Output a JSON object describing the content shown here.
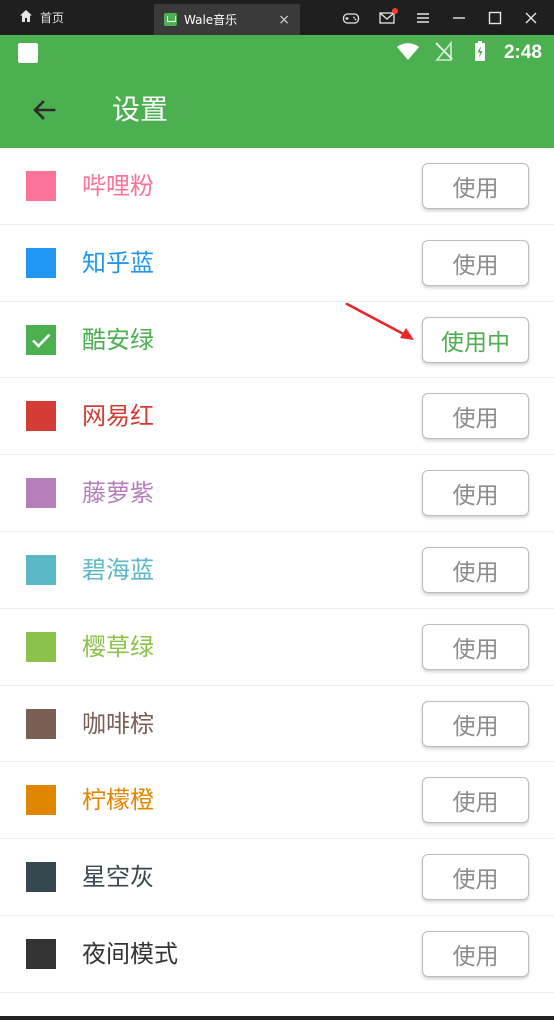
{
  "emulator": {
    "home_label": "首页",
    "tab_title": "Wale音乐",
    "tab_close": "×"
  },
  "status_bar": {
    "time": "2:48"
  },
  "toolbar": {
    "title": "设置"
  },
  "themes": [
    {
      "name": "哔哩粉",
      "color": "#fb7299",
      "button": "使用",
      "active": false
    },
    {
      "name": "知乎蓝",
      "color": "#2196f3",
      "button": "使用",
      "active": false
    },
    {
      "name": "酷安绿",
      "color": "#4caf50",
      "button": "使用中",
      "active": true
    },
    {
      "name": "网易红",
      "color": "#d43c33",
      "button": "使用",
      "active": false
    },
    {
      "name": "藤萝紫",
      "color": "#b57fbb",
      "button": "使用",
      "active": false
    },
    {
      "name": "碧海蓝",
      "color": "#5bb8c7",
      "button": "使用",
      "active": false
    },
    {
      "name": "樱草绿",
      "color": "#8bc34a",
      "button": "使用",
      "active": false
    },
    {
      "name": "咖啡棕",
      "color": "#795e53",
      "button": "使用",
      "active": false
    },
    {
      "name": "柠檬橙",
      "color": "#e08600",
      "button": "使用",
      "active": false
    },
    {
      "name": "星空灰",
      "color": "#37474f",
      "button": "使用",
      "active": false
    },
    {
      "name": "夜间模式",
      "color": "#333333",
      "button": "使用",
      "active": false
    }
  ]
}
